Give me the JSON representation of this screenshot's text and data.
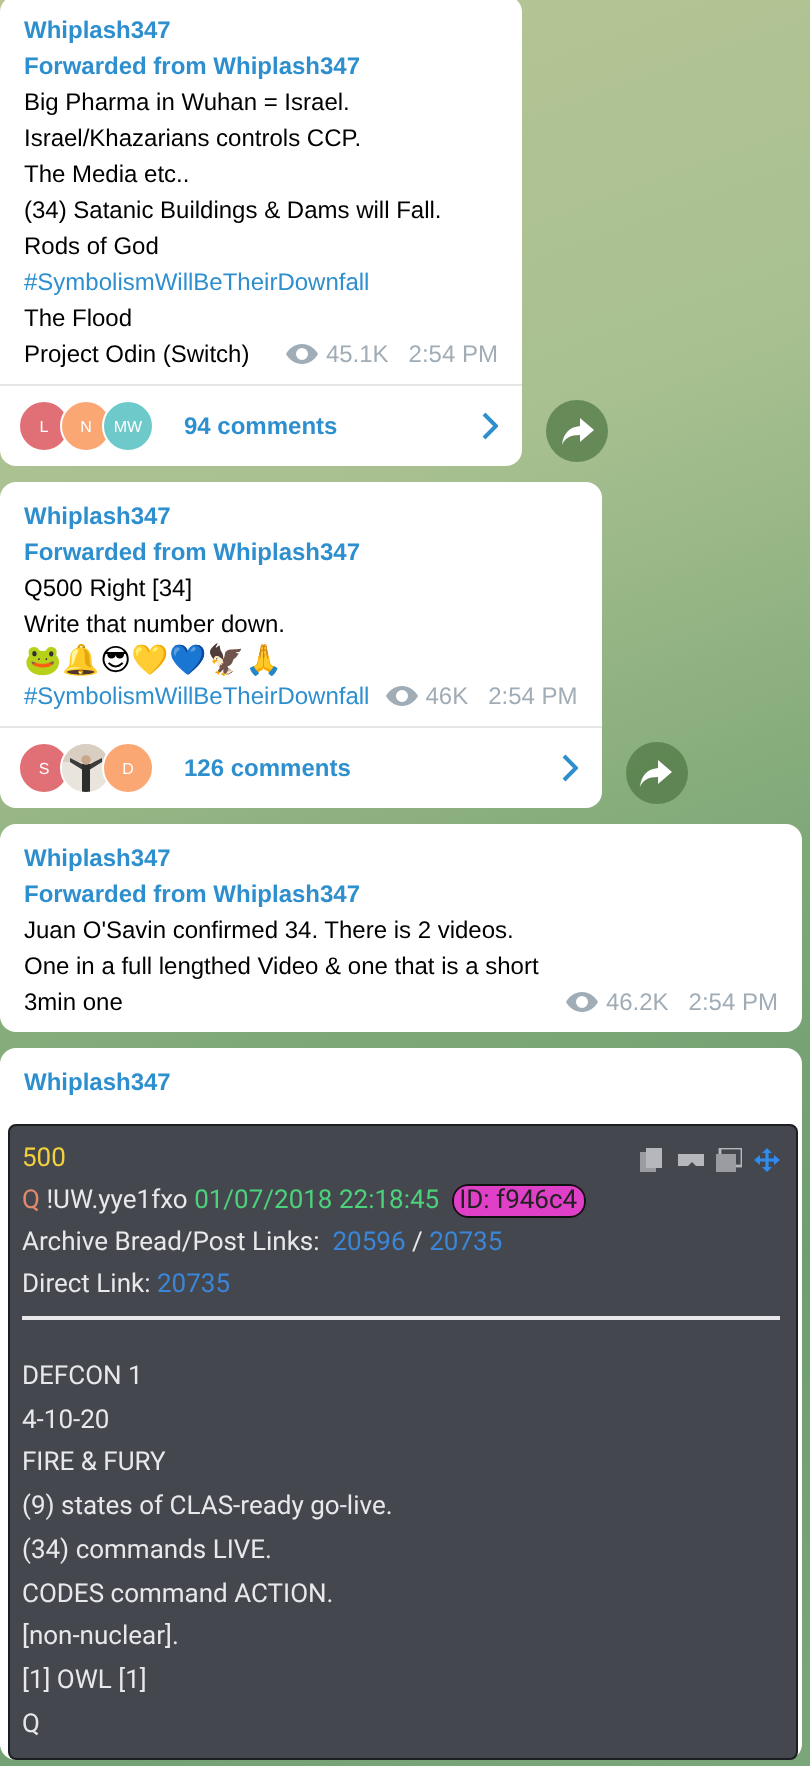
{
  "messages": [
    {
      "author": "Whiplash347",
      "forwarded": "Forwarded from Whiplash347",
      "lines": [
        {
          "kind": "text",
          "text": "Big Pharma in Wuhan = Israel."
        },
        {
          "kind": "text",
          "text": "Israel/Khazarians controls CCP."
        },
        {
          "kind": "text",
          "text": "The Media etc.."
        },
        {
          "kind": "text",
          "text": "(34) Satanic Buildings & Dams will Fall."
        },
        {
          "kind": "text",
          "text": "Rods of God"
        },
        {
          "kind": "hashtag",
          "text": "#SymbolismWillBeTheirDownfall"
        },
        {
          "kind": "text",
          "text": "The Flood"
        },
        {
          "kind": "text",
          "text": "Project Odin (Switch)"
        }
      ],
      "views": "45.1K",
      "time": "2:54 PM",
      "comments": {
        "label": "94 comments",
        "avatars": [
          {
            "kind": "letter",
            "text": "L",
            "color": "#e17076"
          },
          {
            "kind": "letter",
            "text": "N",
            "color": "#faa774"
          },
          {
            "kind": "letter",
            "text": "MW",
            "color": "#6ec9cb"
          }
        ]
      }
    },
    {
      "author": "Whiplash347",
      "forwarded": "Forwarded from Whiplash347",
      "lines": [
        {
          "kind": "text",
          "text": "Q500 Right [34]"
        },
        {
          "kind": "text",
          "text": "Write that number down."
        },
        {
          "kind": "emoji",
          "text": "🐸🔔😎💛💙🦅🙏"
        },
        {
          "kind": "hashtag",
          "text": "#SymbolismWillBeTheirDownfall"
        }
      ],
      "views": "46K",
      "time": "2:54 PM",
      "comments": {
        "label": "126 comments",
        "avatars": [
          {
            "kind": "letter",
            "text": "S",
            "color": "#e17076"
          },
          {
            "kind": "picture"
          },
          {
            "kind": "letter",
            "text": "D",
            "color": "#faa774"
          }
        ]
      }
    },
    {
      "author": "Whiplash347",
      "forwarded": "Forwarded from Whiplash347",
      "lines": [
        {
          "kind": "text",
          "text": "Juan O'Savin confirmed 34. There is 2 videos. One in a full lengthed Video & one that is a short 3min one"
        }
      ],
      "views": "46.2K",
      "time": "2:54 PM"
    },
    {
      "author": "Whiplash347",
      "post": {
        "number": "500",
        "q": "Q",
        "trip": "!UW.yye1fxo",
        "datetime": "01/07/2018 22:18:45",
        "id": "ID: f946c4",
        "archive_label": "Archive Bread/Post Links:",
        "archive_links": [
          "20596",
          "20735"
        ],
        "archive_sep": "/",
        "direct_label": "Direct Link:",
        "direct_link": "20735",
        "lines": [
          "DEFCON 1",
          "4-10-20",
          "FIRE & FURY",
          "(9) states of CLAS-ready go-live.",
          "(34) commands LIVE.",
          "CODES command ACTION.",
          "[non-nuclear].",
          "[1] OWL [1]",
          "Q"
        ]
      }
    }
  ]
}
